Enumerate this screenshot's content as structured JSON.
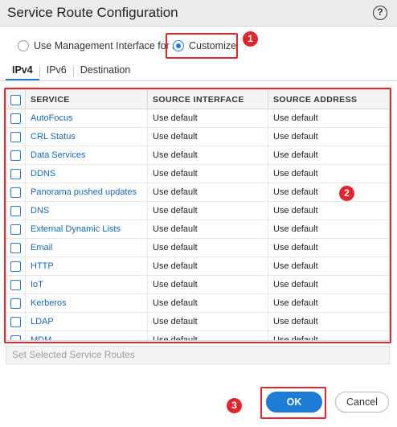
{
  "dialog": {
    "title": "Service Route Configuration",
    "help_label": "?"
  },
  "mode": {
    "option_management": "Use Management Interface for all",
    "option_customize": "Customize",
    "selected": "Customize"
  },
  "tabs": [
    {
      "label": "IPv4",
      "active": true
    },
    {
      "label": "IPv6",
      "active": false
    },
    {
      "label": "Destination",
      "active": false
    }
  ],
  "table": {
    "columns": [
      "SERVICE",
      "SOURCE INTERFACE",
      "SOURCE ADDRESS"
    ],
    "rows": [
      {
        "service": "AutoFocus",
        "source_interface": "Use default",
        "source_address": "Use default"
      },
      {
        "service": "CRL Status",
        "source_interface": "Use default",
        "source_address": "Use default"
      },
      {
        "service": "Data Services",
        "source_interface": "Use default",
        "source_address": "Use default"
      },
      {
        "service": "DDNS",
        "source_interface": "Use default",
        "source_address": "Use default"
      },
      {
        "service": "Panorama pushed updates",
        "source_interface": "Use default",
        "source_address": "Use default"
      },
      {
        "service": "DNS",
        "source_interface": "Use default",
        "source_address": "Use default"
      },
      {
        "service": "External Dynamic Lists",
        "source_interface": "Use default",
        "source_address": "Use default"
      },
      {
        "service": "Email",
        "source_interface": "Use default",
        "source_address": "Use default"
      },
      {
        "service": "HTTP",
        "source_interface": "Use default",
        "source_address": "Use default"
      },
      {
        "service": "IoT",
        "source_interface": "Use default",
        "source_address": "Use default"
      },
      {
        "service": "Kerberos",
        "source_interface": "Use default",
        "source_address": "Use default"
      },
      {
        "service": "LDAP",
        "source_interface": "Use default",
        "source_address": "Use default"
      },
      {
        "service": "MDM",
        "source_interface": "Use default",
        "source_address": "Use default"
      }
    ]
  },
  "actions": {
    "set_selected": "Set Selected Service Routes",
    "ok": "OK",
    "cancel": "Cancel"
  },
  "callouts": [
    "1",
    "2",
    "3"
  ],
  "colors": {
    "accent": "#1d7cd6",
    "highlight": "#e2262c",
    "link": "#1668b5"
  }
}
